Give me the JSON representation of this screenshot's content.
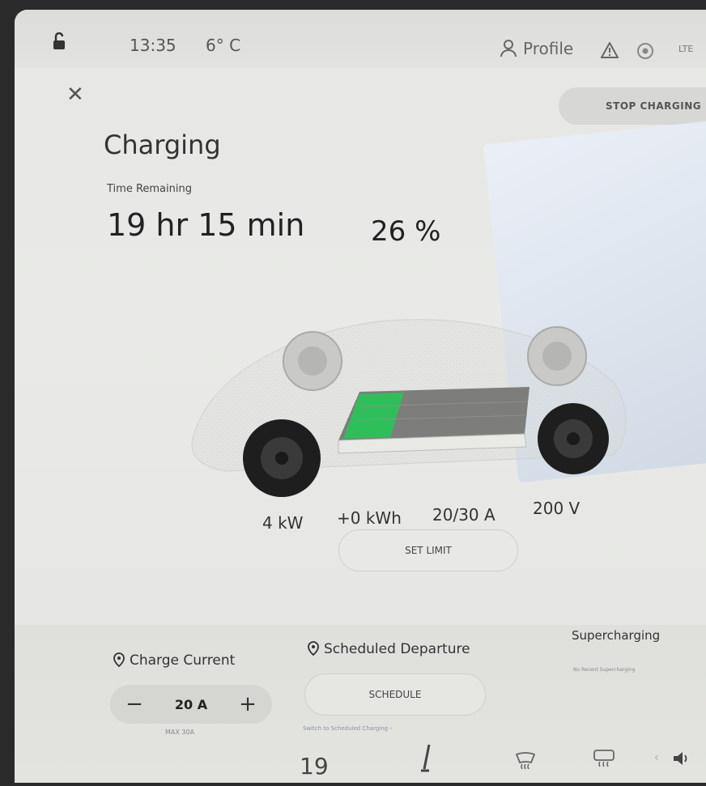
{
  "status_bar": {
    "time": "13:35",
    "temperature": "6° C",
    "profile_label": "Profile",
    "network": "LTE"
  },
  "charging": {
    "title": "Charging",
    "stop_button": "STOP CHARGING",
    "time_remaining_label": "Time Remaining",
    "time_remaining_value": "19 hr 15 min",
    "battery_percent": "26 %",
    "battery_level_fraction": 0.26,
    "stats": {
      "power": "4 kW",
      "energy_added": "+0 kWh",
      "current": "20/30 A",
      "voltage": "200 V"
    },
    "set_limit_button": "SET LIMIT"
  },
  "charge_current": {
    "label": "Charge Current",
    "minus": "−",
    "value": "20 A",
    "plus": "+",
    "max_label": "MAX 30A"
  },
  "scheduled_departure": {
    "label": "Scheduled Departure",
    "schedule_button": "SCHEDULE",
    "note": "Switch to Scheduled Charging ›"
  },
  "supercharging": {
    "label": "Supercharging",
    "note": "No Recent Supercharging"
  },
  "dock": {
    "partial_number": "19"
  },
  "colors": {
    "battery_fill": "#2fbf5a",
    "screen_background": "#e6e7e4"
  }
}
